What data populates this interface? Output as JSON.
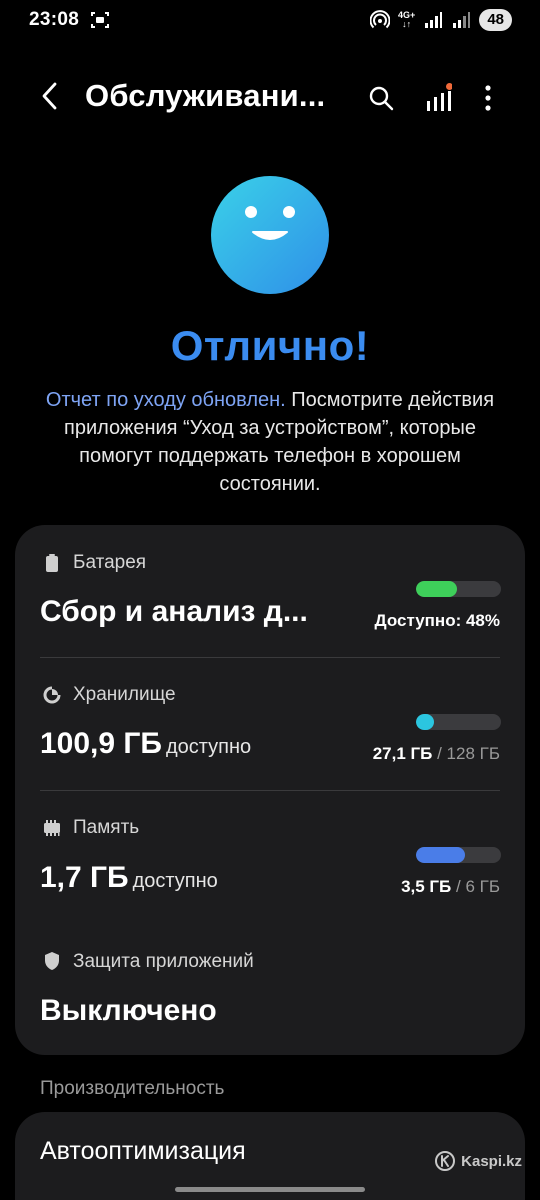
{
  "status_bar": {
    "time": "23:08",
    "network": "4G+",
    "battery": "48"
  },
  "app_bar": {
    "title": "Обслуживани..."
  },
  "hero": {
    "heading": "Отлично!",
    "desc_link": "Отчет по уходу обновлен.",
    "desc_text": " Посмотрите действия приложения “Уход за устройством”, которые помогут поддержать телефон в хорошем состоянии.",
    "accent": "#3b8cf0"
  },
  "battery": {
    "label": "Батарея",
    "value": "Сбор и анализ д...",
    "available": "Доступно: 48%",
    "level": 0.48,
    "color": "#3ecf5a"
  },
  "storage": {
    "label": "Хранилище",
    "value": "100,9 ГБ",
    "unit": "доступно",
    "used": "27,1 ГБ",
    "total": " / 128 ГБ",
    "level": 0.21,
    "color": "#2bc6e0"
  },
  "memory": {
    "label": "Память",
    "value": "1,7 ГБ",
    "unit": "доступно",
    "used": "3,5 ГБ",
    "total": " / 6 ГБ",
    "level": 0.58,
    "color": "#4a7de8"
  },
  "app_protection": {
    "label": "Защита приложений",
    "value": "Выключено"
  },
  "performance": {
    "header": "Производительность",
    "item": "Автооптимизация"
  },
  "watermark": "Kaspi.kz"
}
